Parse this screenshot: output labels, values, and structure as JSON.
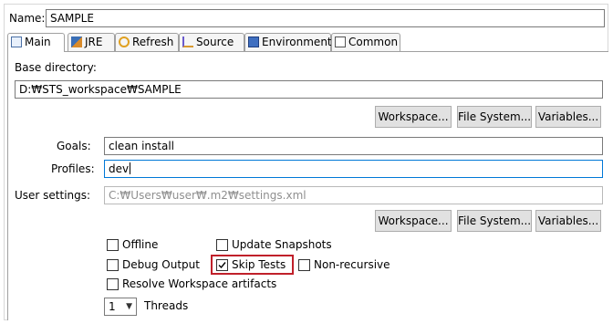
{
  "name": {
    "label": "Name:",
    "value": "SAMPLE"
  },
  "tabs": [
    {
      "label": "Main",
      "icon": "main-tab-icon"
    },
    {
      "label": "JRE",
      "icon": "jre-icon"
    },
    {
      "label": "Refresh",
      "icon": "refresh-icon"
    },
    {
      "label": "Source",
      "icon": "source-icon"
    },
    {
      "label": "Environment",
      "icon": "environment-icon"
    },
    {
      "label": "Common",
      "icon": "common-icon"
    }
  ],
  "base_directory": {
    "label": "Base directory:",
    "value": "D:₩STS_workspace₩SAMPLE",
    "buttons": {
      "workspace": "Workspace...",
      "file_system": "File System...",
      "variables": "Variables..."
    }
  },
  "goals": {
    "label": "Goals:",
    "value": "clean install"
  },
  "profiles": {
    "label": "Profiles:",
    "value": "dev"
  },
  "user_settings": {
    "label": "User settings:",
    "value": "C:₩Users₩user₩.m2₩settings.xml",
    "buttons": {
      "workspace": "Workspace...",
      "file_system": "File System...",
      "variables": "Variables..."
    }
  },
  "options": {
    "offline": "Offline",
    "update_snapshots": "Update Snapshots",
    "debug_output": "Debug Output",
    "skip_tests": "Skip Tests",
    "non_recursive": "Non-recursive",
    "resolve_workspace": "Resolve Workspace artifacts"
  },
  "threads": {
    "value": "1",
    "label": "Threads"
  },
  "colors": {
    "highlight": "#c0202a",
    "focus": "#0078d7"
  }
}
